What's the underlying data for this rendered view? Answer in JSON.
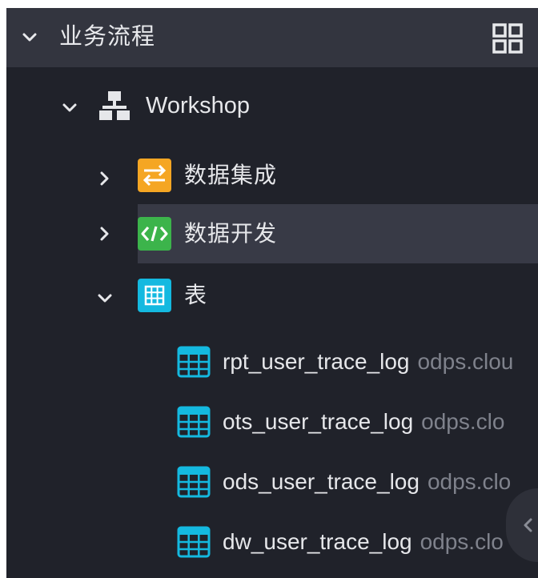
{
  "header": {
    "title": "业务流程",
    "icons": {
      "collapse": "chevron-down-icon",
      "layout": "grid-icon"
    }
  },
  "tree": {
    "workshop": {
      "label": "Workshop",
      "icon": "org-chart-icon",
      "expanded": true
    },
    "data_integration": {
      "label": "数据集成",
      "icon": "swap-arrows-icon",
      "icon_color": "#f5a623",
      "expanded": false
    },
    "data_development": {
      "label": "数据开发",
      "icon": "code-icon",
      "icon_color": "#3cb44b",
      "expanded": false,
      "selected": true
    },
    "tables": {
      "label": "表",
      "icon": "table-icon",
      "icon_color": "#14b9e0",
      "expanded": true,
      "items": [
        {
          "name": "rpt_user_trace_log",
          "source": "odps.clou"
        },
        {
          "name": "ots_user_trace_log",
          "source": "odps.clo"
        },
        {
          "name": "ods_user_trace_log",
          "source": "odps.clo"
        },
        {
          "name": "dw_user_trace_log",
          "source": "odps.clo"
        }
      ]
    }
  },
  "colors": {
    "panel_bg": "#20222a",
    "header_bg": "#33353f",
    "selected_bg": "#383a46",
    "text": "#e6e7ea",
    "muted_text": "#7f828c",
    "table_icon": "#14b9e0"
  }
}
